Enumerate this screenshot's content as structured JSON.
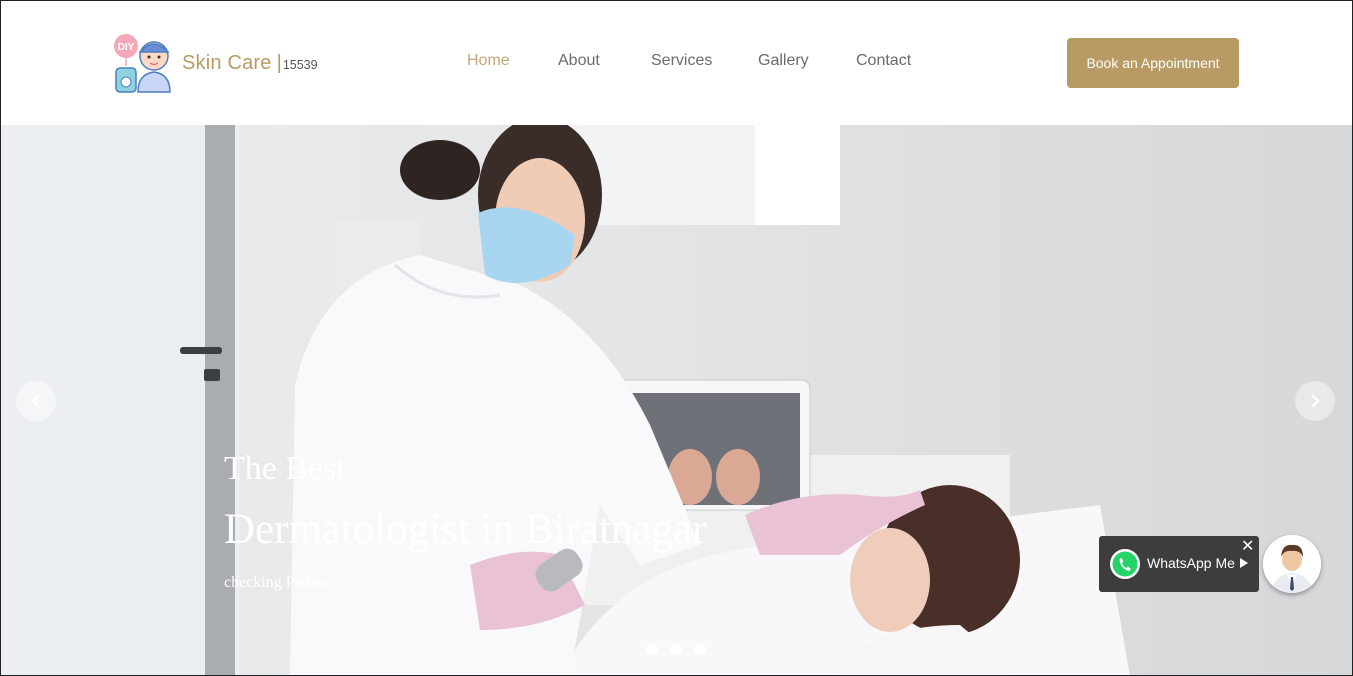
{
  "brand": {
    "name": "Skin Care",
    "separator": "|",
    "code": "15539",
    "logo_text": "DIY"
  },
  "nav": {
    "items": [
      "Home",
      "About",
      "Services",
      "Gallery",
      "Contact"
    ],
    "active": "Home"
  },
  "header": {
    "cta_label": "Book an Appointment"
  },
  "hero": {
    "line1": "The Best",
    "line2": "Dermatologist in Biratnagar",
    "line3": "checking Patient",
    "slide_count": 3
  },
  "whatsapp": {
    "label": "WhatsApp Me"
  },
  "colors": {
    "accent": "#b89a64",
    "nav_active": "#c8a472",
    "nav_text": "#6b6b6b",
    "widget_bg": "#3d3d3d"
  }
}
